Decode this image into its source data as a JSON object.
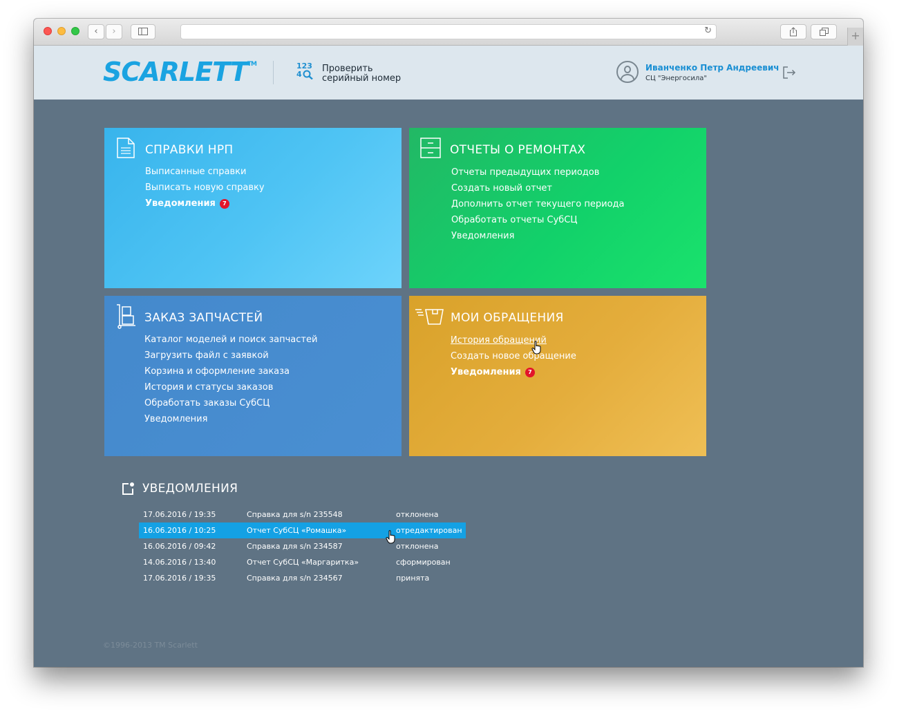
{
  "header": {
    "logo_text": "SCARLETT",
    "logo_tm": "TM",
    "serial_icon_top": "123",
    "serial_icon_bottom": "4",
    "serial_label_line1": "Проверить",
    "serial_label_line2": "серийный номер",
    "user_name": "Иванченко Петр Андреевич",
    "user_org": "СЦ \"Энергосила\""
  },
  "tiles": [
    {
      "title": "СПРАВКИ НРП",
      "icon": "document-icon",
      "links": [
        "Выписанные справки",
        "Выписать новую справку"
      ],
      "notification_label": "Уведомления",
      "badge": "7"
    },
    {
      "title": "ОТЧЕТЫ О РЕМОНТАХ",
      "icon": "cabinet-icon",
      "links": [
        "Отчеты предыдущих периодов",
        "Создать новый отчет",
        "Дополнить отчет текущего периода",
        "Обработать отчеты СубСЦ",
        "Уведомления"
      ]
    },
    {
      "title": "ЗАКАЗ ЗАПЧАСТЕЙ",
      "icon": "hand-truck-icon",
      "links": [
        "Каталог моделей и поиск запчастей",
        "Загрузить файл с заявкой",
        "Корзина и оформление заказа",
        "История и статусы заказов",
        "Обработать заказы СубСЦ",
        "Уведомления"
      ]
    },
    {
      "title": "МОИ ОБРАЩЕНИЯ",
      "icon": "fast-box-icon",
      "links": [
        "История обращений",
        "Создать новое обращение"
      ],
      "notification_label": "Уведомления",
      "badge": "7"
    }
  ],
  "notifications": {
    "title": "УВЕДОМЛЕНИЯ",
    "rows": [
      {
        "date": "17.06.2016 / 19:35",
        "subject": "Справка для  s/n 235548",
        "status": "отклонена"
      },
      {
        "date": "16.06.2016 / 10:25",
        "subject": "Отчет СубСЦ «Ромашка»",
        "status": "отредактирован"
      },
      {
        "date": "16.06.2016 / 09:42",
        "subject": "Справка для  s/n 234587",
        "status": "отклонена"
      },
      {
        "date": "14.06.2016 / 13:40",
        "subject": "Отчет СубСЦ «Маргаритка»",
        "status": "сформирован"
      },
      {
        "date": "17.06.2016 / 19:35",
        "subject": "Справка для  s/n 234567",
        "status": "принята"
      }
    ]
  },
  "footer": "©1996-2013 TM Scarlett",
  "colors": {
    "accent": "#1aa3e1",
    "tile_blue_light": "#4fc4f4",
    "tile_green": "#12d16a",
    "tile_blue": "#4a8fd2",
    "tile_yellow": "#e4ad3c",
    "badge": "#e2142a",
    "background": "#5f7384"
  }
}
